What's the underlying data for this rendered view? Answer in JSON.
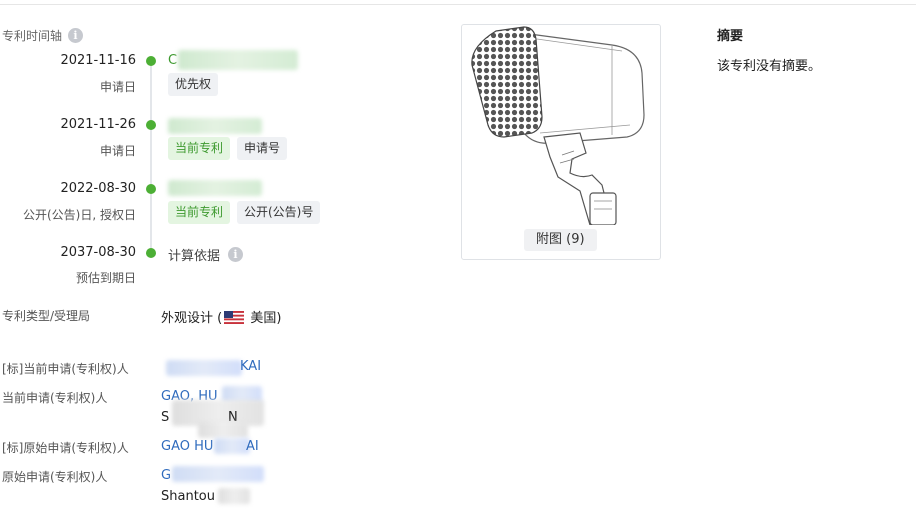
{
  "timeline": {
    "title": "专利时间轴",
    "events": [
      {
        "date": "2021-11-16",
        "label": "申请日",
        "head": "C",
        "tags": [
          "优先权"
        ]
      },
      {
        "date": "2021-11-26",
        "label": "申请日",
        "tags": [
          "当前专利",
          "申请号"
        ]
      },
      {
        "date": "2022-08-30",
        "label": "公开(公告)日, 授权日",
        "tags": [
          "当前专利",
          "公开(公告)号"
        ]
      },
      {
        "date": "2037-08-30",
        "label": "预估到期日",
        "head": "计算依据"
      }
    ]
  },
  "figure": {
    "caption": "附图 (9)"
  },
  "abstract": {
    "title": "摘要",
    "body": "该专利没有摘要。"
  },
  "fields": {
    "type_label": "专利类型/受理局",
    "type_value": "外观设计 (",
    "country": "美国)",
    "std_current_applicant_label": "[标]当前申请(专利权)人",
    "std_current_applicant_value": "KAI",
    "current_applicant_label": "当前申请(专利权)人",
    "current_applicant_value": "GAO, HU",
    "current_applicant_addr": "S",
    "current_applicant_addr2": "N",
    "std_original_applicant_label": "[标]原始申请(专利权)人",
    "std_original_applicant_value": "GAO HU",
    "std_original_applicant_value2": "AI",
    "original_applicant_label": "原始申请(专利权)人",
    "original_applicant_value": "G",
    "original_applicant_addr": "Shantou"
  },
  "icons": {
    "info": "info-icon",
    "flag": "us-flag-icon"
  }
}
